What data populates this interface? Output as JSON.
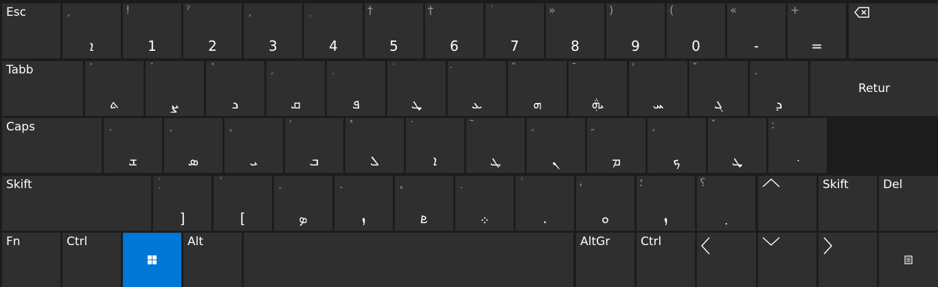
{
  "keyboard": {
    "row1": {
      "esc": "Esc",
      "keys": [
        {
          "sym": "ˏ",
          "glyph": "ܐ"
        },
        {
          "sym": "!",
          "glyph": "1"
        },
        {
          "sym": "ˀ",
          "glyph": "2"
        },
        {
          "sym": "ˏ",
          "glyph": "3"
        },
        {
          "sym": "ܼ",
          "glyph": "4"
        },
        {
          "sym": "†",
          "glyph": "5"
        },
        {
          "sym": "†",
          "glyph": "6"
        },
        {
          "sym": "ܿ",
          "glyph": "7"
        },
        {
          "sym": "»",
          "glyph": "8"
        },
        {
          "sym": ")",
          "glyph": "9"
        },
        {
          "sym": "(",
          "glyph": "0"
        },
        {
          "sym": "«",
          "glyph": "-"
        },
        {
          "sym": "+",
          "glyph": "="
        }
      ],
      "backspace_icon": "backspace-icon"
    },
    "row2": {
      "tab": "Tabb",
      "keys": [
        {
          "sym": "ܰ",
          "glyph": "ܬ"
        },
        {
          "sym": "ܳ",
          "glyph": "ܨ"
        },
        {
          "sym": "ܶ",
          "glyph": "ܖ"
        },
        {
          "sym": "ܹ",
          "glyph": "ܩ"
        },
        {
          "sym": "ܼ",
          "glyph": "ܦ"
        },
        {
          "sym": "ܿ",
          "glyph": "ܜ"
        },
        {
          "sym": "݀",
          "glyph": "ܥ"
        },
        {
          "sym": "ˇ",
          "glyph": "ܗ"
        },
        {
          "sym": "ˉ",
          "glyph": "ܞ"
        },
        {
          "sym": "ˈ",
          "glyph": "ܚ"
        },
        {
          "sym": "ˇ",
          "glyph": "ܓ"
        },
        {
          "sym": "ܸ",
          "glyph": "ܕ"
        }
      ],
      "enter": "Retur"
    },
    "row3": {
      "caps": "Caps",
      "keys": [
        {
          "sym": "ܱ",
          "glyph": "ܫ"
        },
        {
          "sym": "ܴ",
          "glyph": "ܣ"
        },
        {
          "sym": "ܷ",
          "glyph": "ܝ"
        },
        {
          "sym": "ܺ",
          "glyph": "ܒ"
        },
        {
          "sym": "ܽ",
          "glyph": "ܠ"
        },
        {
          "sym": "݁",
          "glyph": "ܐ"
        },
        {
          "sym": "ˉ",
          "glyph": "ܛ"
        },
        {
          "sym": "ˏ",
          "glyph": "ܢ"
        },
        {
          "sym": "ˍ",
          "glyph": "ܡ"
        },
        {
          "sym": "ˏ",
          "glyph": "ܟ"
        },
        {
          "sym": "ˇ",
          "glyph": "ܜ"
        },
        {
          "sym": ":",
          "glyph": "݀"
        }
      ]
    },
    "row4": {
      "shift_left": "Skift",
      "keys": [
        {
          "sym": "ܲ",
          "glyph": "]"
        },
        {
          "sym": "ܵ",
          "glyph": "["
        },
        {
          "sym": "ܸ",
          "glyph": "ܤ"
        },
        {
          "sym": "ܻ",
          "glyph": "ܙ"
        },
        {
          "sym": "ܾ",
          "glyph": "ܧ"
        },
        {
          "sym": "݂",
          "glyph": "܀"
        },
        {
          "sym": "݃",
          "glyph": "."
        },
        {
          "sym": "،",
          "glyph": "ܘ"
        },
        {
          "sym": "؛",
          "glyph": "ܙ"
        },
        {
          "sym": "؟",
          "glyph": "܂"
        }
      ],
      "shift_right": "Skift",
      "del": "Del"
    },
    "row5": {
      "fn": "Fn",
      "ctrl_left": "Ctrl",
      "alt": "Alt",
      "altgr": "AltGr",
      "ctrl_right": "Ctrl"
    },
    "colors": {
      "key_bg": "#2f2f2f",
      "board_bg": "#1c1c1c",
      "accent": "#0078d7"
    }
  }
}
